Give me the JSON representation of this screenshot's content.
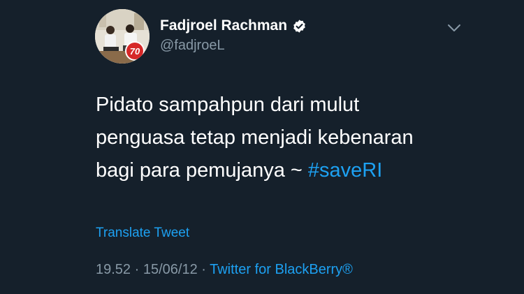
{
  "author": {
    "name": "Fadjroel Rachman",
    "handle": "@fadjroeL",
    "avatar_badge": "70",
    "verified": true
  },
  "tweet": {
    "lines": [
      "Pidato sampahpun dari mulut",
      "penguasa tetap menjadi kebenaran",
      "bagi para pemujanya ~ "
    ],
    "hashtag": "#saveRI"
  },
  "translate_label": "Translate Tweet",
  "meta": {
    "time": "19.52",
    "separator1": " · ",
    "date": "15/06/12",
    "separator2": " · ",
    "source": "Twitter for BlackBerry®"
  },
  "colors": {
    "background": "#15202b",
    "accent": "#1da1f2",
    "muted": "#8899a6",
    "text": "#ffffff"
  },
  "icons": {
    "verified": "verified-badge-icon",
    "menu": "chevron-down-icon"
  }
}
